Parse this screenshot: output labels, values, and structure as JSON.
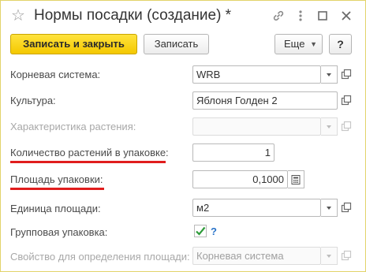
{
  "window": {
    "title": "Нормы посадки (создание) *"
  },
  "toolbar": {
    "save_close_label": "Записать и закрыть",
    "save_label": "Записать",
    "more_label": "Еще",
    "help_label": "?"
  },
  "form": {
    "root_system": {
      "label": "Корневая система:",
      "value": "WRB"
    },
    "culture": {
      "label": "Культура:",
      "value": "Яблоня Голден 2"
    },
    "plant_characteristic": {
      "label": "Характеристика растения:",
      "value": ""
    },
    "plants_per_pack": {
      "label": "Количество растений в упаковке:",
      "value": "1"
    },
    "pack_area": {
      "label": "Площадь упаковки:",
      "value": "0,1000"
    },
    "area_unit": {
      "label": "Единица площади:",
      "value": "м2"
    },
    "group_pack": {
      "label": "Групповая упаковка:",
      "checked": true,
      "help": "?"
    },
    "area_property": {
      "label": "Свойство для определения площади:",
      "value": "Корневая система"
    }
  },
  "colors": {
    "primary_button": "#f4c800",
    "highlight_underline": "#e01d1d",
    "checkmark": "#2e9b3a",
    "help_link": "#2a74c9"
  }
}
